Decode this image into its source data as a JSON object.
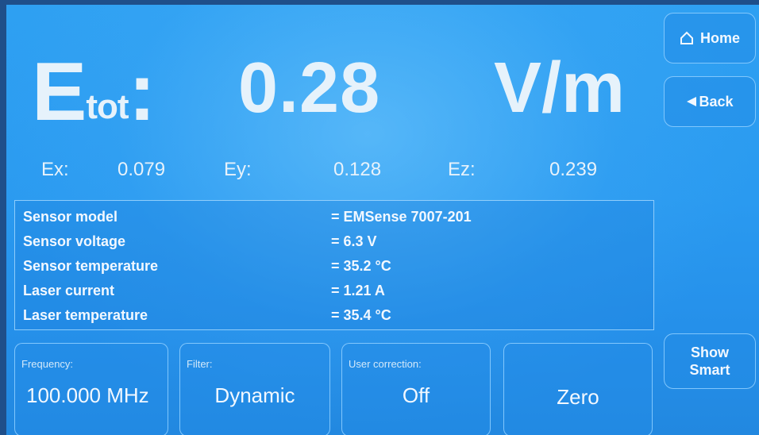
{
  "measurement": {
    "etot_main": "E",
    "etot_sub": "tot",
    "etot_colon": ":",
    "value": "0.28",
    "unit": "V/m"
  },
  "nav": {
    "home_label": "Home",
    "back_label": "Back",
    "show_smart_line1": "Show",
    "show_smart_line2": "Smart"
  },
  "components": {
    "ex_label": "Ex:",
    "ex_value": "0.079",
    "ey_label": "Ey:",
    "ey_value": "0.128",
    "ez_label": "Ez:",
    "ez_value": "0.239"
  },
  "info": [
    {
      "key": "Sensor model",
      "value": "= EMSense 7007-201"
    },
    {
      "key": "Sensor voltage",
      "value": "= 6.3 V"
    },
    {
      "key": "Sensor temperature",
      "value": "= 35.2 °C"
    },
    {
      "key": "Laser current",
      "value": "= 1.21 A"
    },
    {
      "key": "Laser temperature",
      "value": "= 35.4  °C"
    }
  ],
  "controls": {
    "frequency_caption": "Frequency:",
    "frequency_value": "100.000 MHz",
    "filter_caption": "Filter:",
    "filter_value": "Dynamic",
    "user_correction_caption": "User correction:",
    "user_correction_value": "Off",
    "zero_label": "Zero"
  },
  "colors": {
    "background": "#2a9af0",
    "text": "#e6f2fb"
  }
}
